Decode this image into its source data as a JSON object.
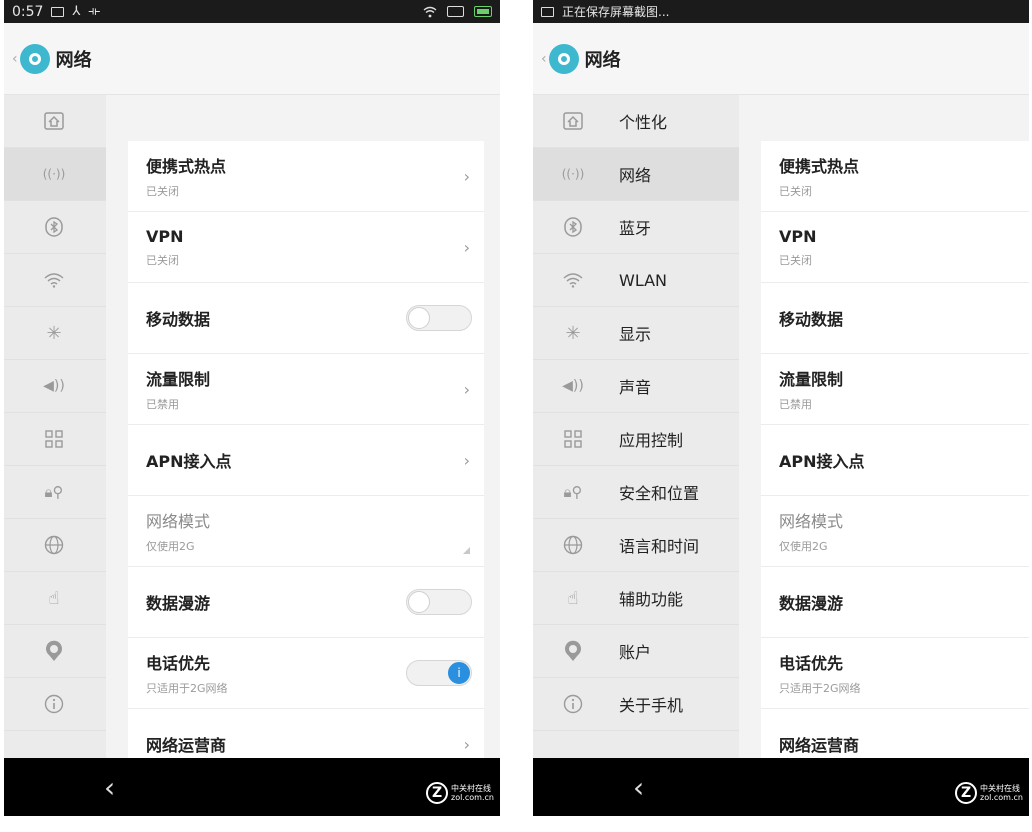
{
  "left": {
    "status": {
      "time": "0:57"
    },
    "title": "网络",
    "sidebar_icons": [
      "home-icon",
      "hotspot-icon",
      "bluetooth-icon",
      "wifi-icon",
      "brightness-icon",
      "volume-icon",
      "apps-grid-icon",
      "security-location-icon",
      "globe-icon",
      "hand-icon",
      "account-icon",
      "info-icon"
    ]
  },
  "right": {
    "status": {
      "saving": "正在保存屏幕截图..."
    },
    "title": "网络",
    "sidebar": [
      {
        "label": "个性化"
      },
      {
        "label": "网络"
      },
      {
        "label": "蓝牙"
      },
      {
        "label": "WLAN"
      },
      {
        "label": "显示"
      },
      {
        "label": "声音"
      },
      {
        "label": "应用控制"
      },
      {
        "label": "安全和位置"
      },
      {
        "label": "语言和时间"
      },
      {
        "label": "辅助功能"
      },
      {
        "label": "账户"
      },
      {
        "label": "关于手机"
      }
    ]
  },
  "rows": [
    {
      "title": "便携式热点",
      "sub": "已关闭",
      "control": "chevron"
    },
    {
      "title": "VPN",
      "sub": "已关闭",
      "control": "chevron"
    },
    {
      "title": "移动数据",
      "sub": "",
      "control": "toggle-off"
    },
    {
      "title": "流量限制",
      "sub": "已禁用",
      "control": "chevron"
    },
    {
      "title": "APN接入点",
      "sub": "",
      "control": "chevron"
    },
    {
      "title": "网络模式",
      "sub": "仅使用2G",
      "control": "select"
    },
    {
      "title": "数据漫游",
      "sub": "",
      "control": "toggle-off"
    },
    {
      "title": "电话优先",
      "sub": "只适用于2G网络",
      "control": "toggle-on"
    },
    {
      "title": "网络运营商",
      "sub": "",
      "control": "chevron"
    }
  ],
  "chevron_glyph": "›",
  "toggle_on_glyph": "i",
  "nav": {
    "back": "‹"
  },
  "watermark": {
    "mark": "Z",
    "line1": "中关村在线",
    "line2": "zol.com.cn"
  },
  "colors": {
    "accent": "#2a8fde",
    "title_icon": "#3db8cf"
  }
}
